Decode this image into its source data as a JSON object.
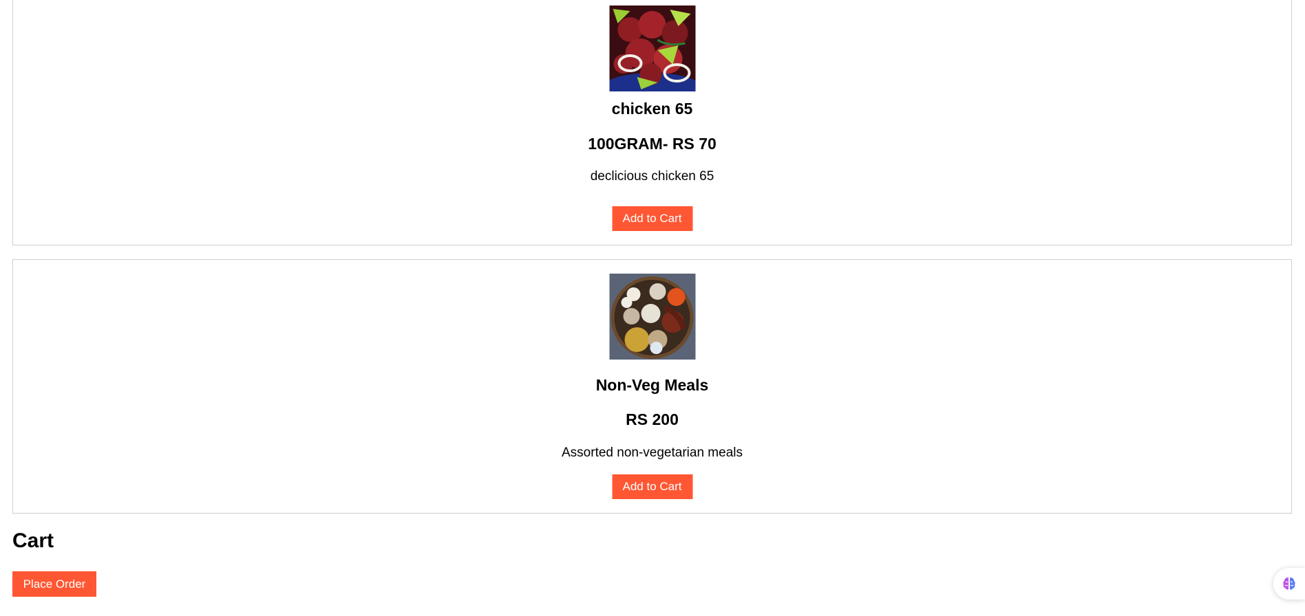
{
  "menu": {
    "items": [
      {
        "name": "chicken 65",
        "price": "100GRAM- RS 70",
        "description": "declicious chicken 65",
        "button_label": "Add to Cart",
        "image": "chicken-65-dish-image"
      },
      {
        "name": "Non-Veg Meals",
        "price": "RS 200",
        "description": "Assorted non-vegetarian meals",
        "button_label": "Add to Cart",
        "image": "non-veg-meals-platter-image"
      }
    ]
  },
  "cart": {
    "heading": "Cart",
    "place_order_label": "Place Order"
  },
  "colors": {
    "accent": "#ff5733",
    "card_border": "#cfcfcf"
  },
  "icons": {
    "assistant": "brain-icon"
  }
}
